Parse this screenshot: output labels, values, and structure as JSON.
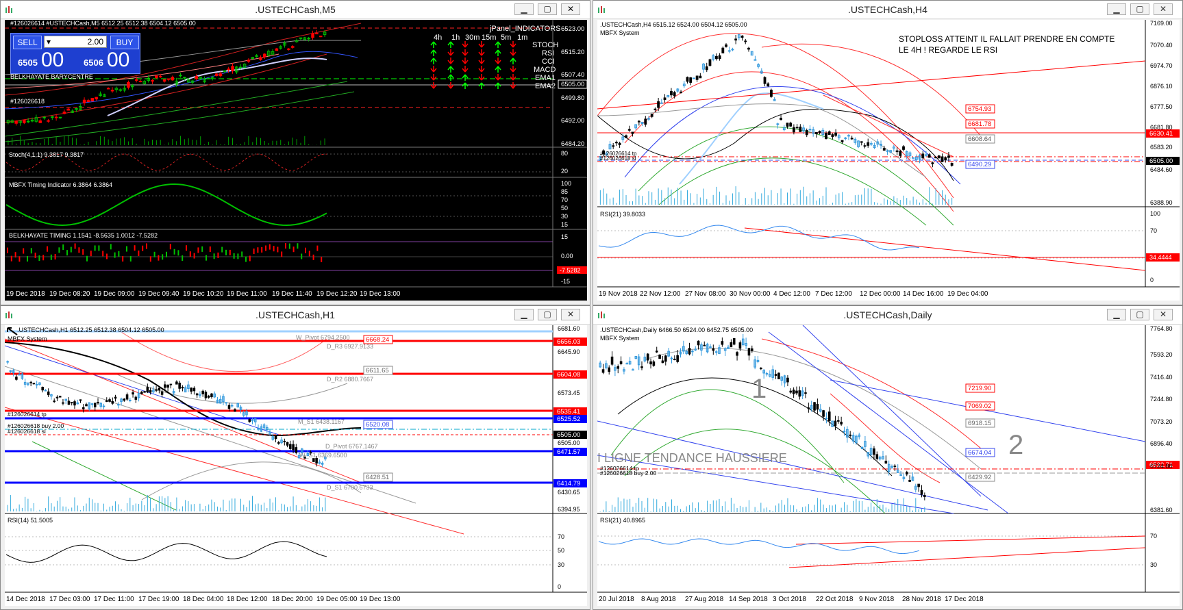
{
  "windows": {
    "m5": {
      "title": ".USTECHCash,M5",
      "header": "#126026614 #USTECHCash,M5  6512.25 6512.38 6504.12 6505.00",
      "trade": {
        "sell_label": "SELL",
        "buy_label": "BUY",
        "lot": "2.00",
        "sell_small": "6505",
        "sell_big": "00",
        "buy_small": "6506",
        "buy_big": "00"
      },
      "overlay_labels": [
        "BELKHAYATE BARYCENTRE",
        "#126026618"
      ],
      "price_axis": [
        "6523.00",
        "6515.20",
        "6507.40",
        "6505.00",
        "6499.80",
        "6492.00",
        "6484.20"
      ],
      "panel": {
        "title": "jPanel_INDICATORS",
        "timeframes": [
          "4h",
          "1h",
          "30m",
          "15m",
          "5m",
          "1m"
        ],
        "indicators": [
          "STOCH",
          "RSI",
          "CCI",
          "MACD",
          "EMA1",
          "EMA2"
        ],
        "arrows": [
          [
            "up",
            "up",
            "down",
            "down",
            "up",
            "down"
          ],
          [
            "up",
            "down",
            "down",
            "down",
            "up",
            "down"
          ],
          [
            "up",
            "down",
            "down",
            "down",
            "down",
            "up"
          ],
          [
            "down",
            "up",
            "down",
            "down",
            "up",
            "down"
          ],
          [
            "down",
            "up",
            "up",
            "down",
            "down",
            "down"
          ],
          [
            "down",
            "down",
            "up",
            "up",
            "up",
            "down"
          ]
        ]
      },
      "stoch_label": "Stoch(4,1,1) 9.3817 9.3817",
      "stoch_axis": [
        "80",
        "20"
      ],
      "timing_label": "MBFX Timing Indicator 6.3864 6.3864",
      "timing_axis": [
        "100",
        "85",
        "70",
        "50",
        "30",
        "15",
        "0"
      ],
      "bk_label": "BELKHAYATE TIMING  1.1541 -8.5635 1.0012 -7.5282",
      "bk_axis": [
        "15",
        "0.00",
        "-7.5282",
        "-15"
      ],
      "time_axis": [
        "19 Dec 2018",
        "19 Dec 08:20",
        "19 Dec 09:00",
        "19 Dec 09:40",
        "19 Dec 10:20",
        "19 Dec 11:00",
        "19 Dec 11:40",
        "19 Dec 12:20",
        "19 Dec 13:00"
      ]
    },
    "h4": {
      "title": ".USTECHCash,H4",
      "header": ".USTECHCash,H4  6515.12 6524.00 6504.12 6505.00",
      "system": "MBFX System",
      "note": "STOPLOSS ATTEINT IL FALLAIT PRENDRE EN COMPTE LE 4H ! REGARDE LE RSI",
      "price_axis": [
        "7169.00",
        "7070.40",
        "6974.70",
        "6876.10",
        "6777.50",
        "6681.80",
        "6583.20",
        "6484.60",
        "6388.90"
      ],
      "price_tags": [
        "6754.93",
        "6681.78",
        "6630.41",
        "6608.64",
        "6505.00",
        "6490.29"
      ],
      "order_labels": [
        "#126026614 tp",
        "#126026618 sl"
      ],
      "rsi_label": "RSI(21) 39.8033",
      "rsi_axis": [
        "100",
        "70",
        "34.4444",
        "0"
      ],
      "time_axis": [
        "19 Nov 2018",
        "22 Nov 12:00",
        "27 Nov 08:00",
        "30 Nov 00:00",
        "4 Dec 12:00",
        "7 Dec 12:00",
        "12 Dec 00:00",
        "14 Dec 16:00",
        "19 Dec 04:00"
      ]
    },
    "h1": {
      "title": ".USTECHCash,H1",
      "header": ".USTECHCash,H1  6512.25 6512.38 6504.12 6505.00",
      "system": "MBFX System",
      "pivot_labels": [
        "W_Pivot 6794.2500",
        "D_R3 6927.9133",
        "D_R2 6880.7667",
        "M_S1 6438.1167",
        "D_Pivot 6767.1467",
        "W_S1 6369.6500",
        "D_S1 6700.6733"
      ],
      "order_labels": [
        "#126026614 tp",
        "#126026618 buy 2.00",
        "#126026618 sl"
      ],
      "price_axis": [
        "6681.60",
        "6645.90",
        "6573.45",
        "6505.00",
        "6430.65",
        "6394.95"
      ],
      "price_tags": [
        "6668.24",
        "6656.03",
        "6611.65",
        "6604.08",
        "6535.41",
        "6525.52",
        "6520.08",
        "6505.00",
        "6471.57",
        "6428.51",
        "6414.79"
      ],
      "rsi_label": "RSI(14) 51.5005",
      "rsi_axis": [
        "70",
        "50",
        "30",
        "0"
      ],
      "time_axis": [
        "14 Dec 2018",
        "17 Dec 03:00",
        "17 Dec 11:00",
        "17 Dec 19:00",
        "18 Dec 04:00",
        "18 Dec 12:00",
        "18 Dec 20:00",
        "19 Dec 05:00",
        "19 Dec 13:00"
      ]
    },
    "d1": {
      "title": ".USTECHCash,Daily",
      "header": ".USTECHCash,Daily  6466.50 6524.00 6452.75 6505.00",
      "system": "MBFX System",
      "annotation_1": "1",
      "annotation_2": "2",
      "trend_text": "I LIGNE TENDANCE HAUSSIERE",
      "order_labels": [
        "#126026614 tp",
        "#126026618 buy 2.00"
      ],
      "price_axis": [
        "7764.80",
        "7593.20",
        "7416.40",
        "7244.80",
        "7073.20",
        "6896.40",
        "6724.80",
        "6381.60"
      ],
      "price_tags": [
        "7219.90",
        "7069.02",
        "6918.15",
        "6674.04",
        "6532.71",
        "6429.92"
      ],
      "rsi_label": "RSI(21) 40.8965",
      "rsi_axis": [
        "70",
        "30"
      ],
      "time_axis": [
        "20 Jul 2018",
        "8 Aug 2018",
        "27 Aug 2018",
        "14 Sep 2018",
        "3 Oct 2018",
        "22 Oct 2018",
        "9 Nov 2018",
        "28 Nov 2018",
        "17 Dec 2018"
      ]
    }
  },
  "colors": {
    "bull": "#00c000",
    "bear": "#ff0000",
    "bull_light": "#33ccff",
    "chart_black": "#000000"
  }
}
